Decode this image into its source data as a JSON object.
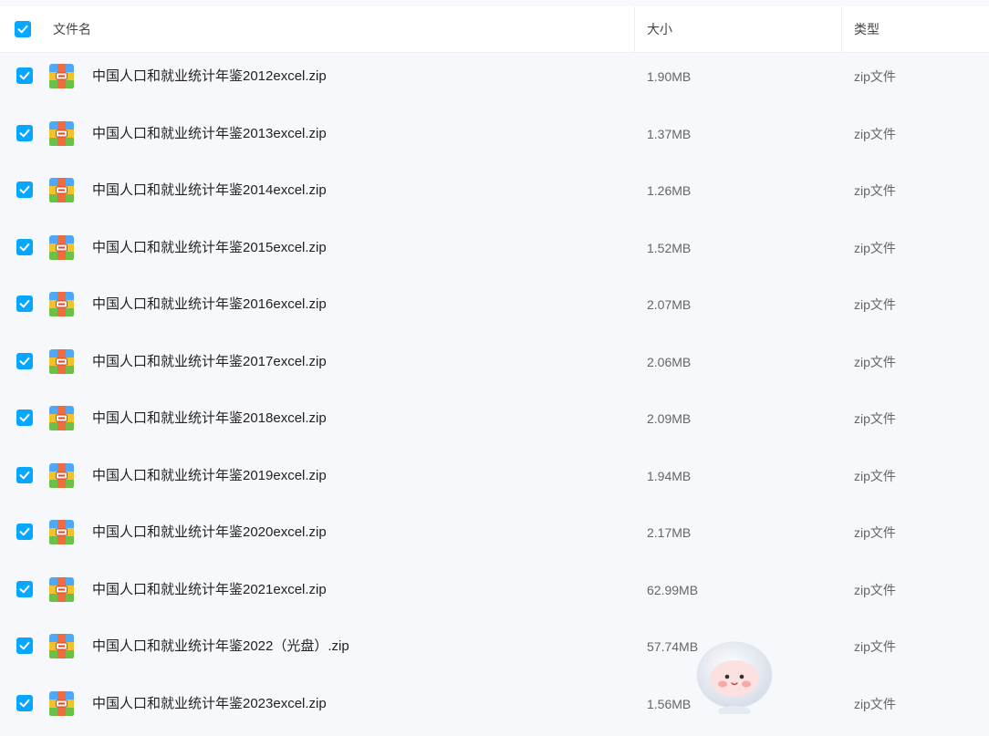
{
  "header": {
    "name_label": "文件名",
    "size_label": "大小",
    "type_label": "类型",
    "select_all_checked": true
  },
  "colors": {
    "accent": "#06a7ff",
    "background": "#f7f8fc"
  },
  "icons": {
    "file": "zip-archive-icon",
    "check": "checkmark-icon"
  },
  "files": [
    {
      "name": "中国人口和就业统计年鉴2012excel.zip",
      "size": "1.90MB",
      "type": "zip文件",
      "checked": true
    },
    {
      "name": "中国人口和就业统计年鉴2013excel.zip",
      "size": "1.37MB",
      "type": "zip文件",
      "checked": true
    },
    {
      "name": "中国人口和就业统计年鉴2014excel.zip",
      "size": "1.26MB",
      "type": "zip文件",
      "checked": true
    },
    {
      "name": "中国人口和就业统计年鉴2015excel.zip",
      "size": "1.52MB",
      "type": "zip文件",
      "checked": true
    },
    {
      "name": "中国人口和就业统计年鉴2016excel.zip",
      "size": "2.07MB",
      "type": "zip文件",
      "checked": true
    },
    {
      "name": "中国人口和就业统计年鉴2017excel.zip",
      "size": "2.06MB",
      "type": "zip文件",
      "checked": true
    },
    {
      "name": "中国人口和就业统计年鉴2018excel.zip",
      "size": "2.09MB",
      "type": "zip文件",
      "checked": true
    },
    {
      "name": "中国人口和就业统计年鉴2019excel.zip",
      "size": "1.94MB",
      "type": "zip文件",
      "checked": true
    },
    {
      "name": "中国人口和就业统计年鉴2020excel.zip",
      "size": "2.17MB",
      "type": "zip文件",
      "checked": true
    },
    {
      "name": "中国人口和就业统计年鉴2021excel.zip",
      "size": "62.99MB",
      "type": "zip文件",
      "checked": true
    },
    {
      "name": "中国人口和就业统计年鉴2022（光盘）.zip",
      "size": "57.74MB",
      "type": "zip文件",
      "checked": true
    },
    {
      "name": "中国人口和就业统计年鉴2023excel.zip",
      "size": "1.56MB",
      "type": "zip文件",
      "checked": true
    }
  ]
}
